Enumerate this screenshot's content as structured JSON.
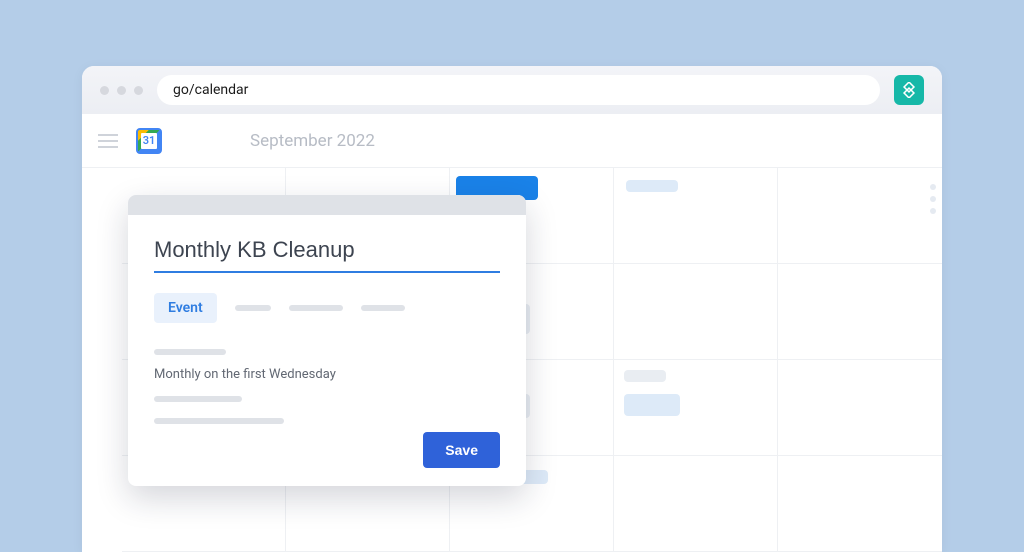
{
  "browser": {
    "url": "go/calendar"
  },
  "calendar": {
    "logo_day": "31",
    "month_label": "September 2022"
  },
  "dialog": {
    "title": "Monthly KB Cleanup",
    "type_label": "Event",
    "recurrence": "Monthly on the first Wednesday",
    "save_label": "Save"
  },
  "colors": {
    "accent": "#2f62d9",
    "accent_light": "#e9f1fc",
    "panel_bg": "#b4cde8",
    "extension": "#16b8a8"
  }
}
